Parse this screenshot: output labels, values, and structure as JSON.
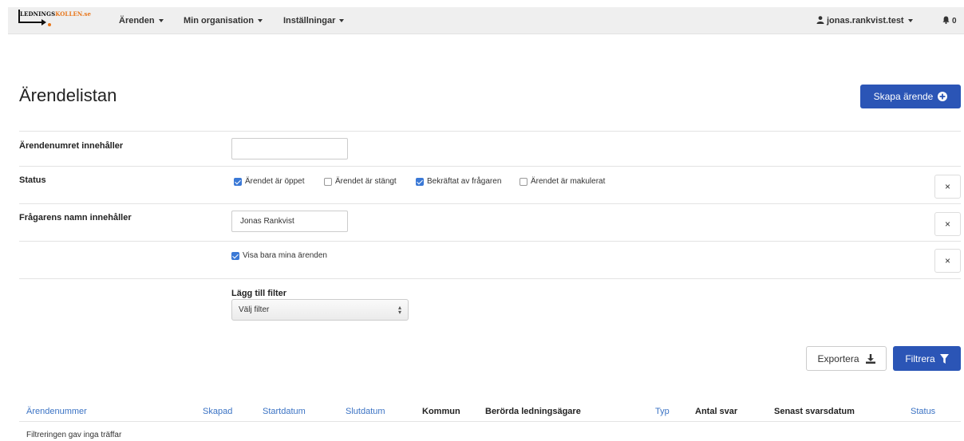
{
  "navbar": {
    "logo_dark": "LEDNINGS",
    "logo_orange": "KOLLEN.se",
    "menu": [
      {
        "label": "Ärenden"
      },
      {
        "label": "Min organisation"
      },
      {
        "label": "Inställningar"
      }
    ],
    "user": "jonas.rankvist.test",
    "notifications": "0"
  },
  "page": {
    "title": "Ärendelistan",
    "create_button": "Skapa ärende"
  },
  "filters": {
    "case_number_label": "Ärendenumret innehåller",
    "case_number_value": "",
    "status_label": "Status",
    "status_options": [
      {
        "label": "Ärendet är öppet",
        "checked": true
      },
      {
        "label": "Ärendet är stängt",
        "checked": false
      },
      {
        "label": "Bekräftat av frågaren",
        "checked": true
      },
      {
        "label": "Ärendet är makulerat",
        "checked": false
      }
    ],
    "requester_label": "Frågarens namn innehåller",
    "requester_value": "Jonas Rankvist",
    "only_mine_label": "Visa bara mina ärenden",
    "only_mine_checked": true,
    "remove_symbol": "×",
    "add_filter_label": "Lägg till filter",
    "add_filter_select": "Välj filter"
  },
  "actions": {
    "export": "Exportera",
    "filter": "Filtrera"
  },
  "table": {
    "columns": [
      {
        "label": "Ärendenummer",
        "sortable": true
      },
      {
        "label": "Skapad",
        "sortable": true
      },
      {
        "label": "Startdatum",
        "sortable": true
      },
      {
        "label": "Slutdatum",
        "sortable": true
      },
      {
        "label": "Kommun",
        "sortable": false
      },
      {
        "label": "Berörda ledningsägare",
        "sortable": false
      },
      {
        "label": "Typ",
        "sortable": true
      },
      {
        "label": "Antal svar",
        "sortable": false
      },
      {
        "label": "Senast svarsdatum",
        "sortable": false
      },
      {
        "label": "Status",
        "sortable": true
      }
    ],
    "empty_message": "Filtreringen gav inga träffar"
  },
  "colors": {
    "primary": "#2b55b6",
    "link": "#3b73c4",
    "checkbox": "#3b79d6",
    "logo_orange": "#e8761a"
  }
}
